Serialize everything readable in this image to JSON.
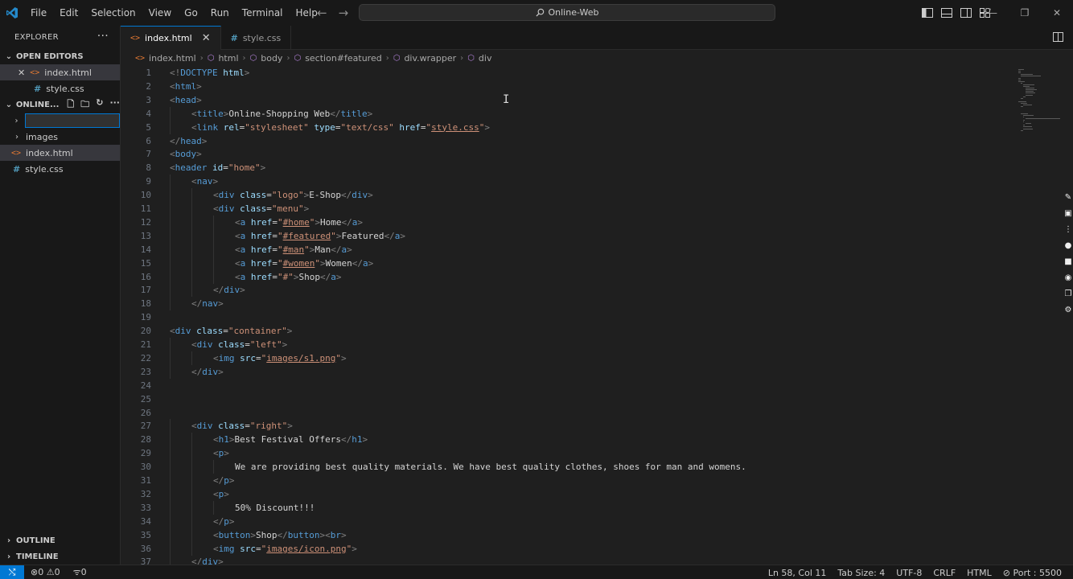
{
  "titlebar": {
    "menu": [
      "File",
      "Edit",
      "Selection",
      "View",
      "Go",
      "Run",
      "Terminal",
      "Help"
    ],
    "search": "Online-Web"
  },
  "sidebar": {
    "explorer_title": "EXPLORER",
    "open_editors_title": "OPEN EDITORS",
    "open_editors": [
      {
        "name": "index.html",
        "type": "html"
      },
      {
        "name": "style.css",
        "type": "css"
      }
    ],
    "folder_title": "ONLINE...",
    "tree": [
      {
        "name": "images",
        "type": "folder"
      },
      {
        "name": "index.html",
        "type": "html"
      },
      {
        "name": "style.css",
        "type": "css"
      }
    ],
    "outline": "OUTLINE",
    "timeline": "TIMELINE"
  },
  "tabs": [
    {
      "label": "index.html",
      "active": true
    },
    {
      "label": "style.css",
      "active": false
    }
  ],
  "breadcrumb": [
    "index.html",
    "html",
    "body",
    "section#featured",
    "div.wrapper",
    "div"
  ],
  "editor": {
    "lines": [
      {
        "n": 1,
        "indent": 0,
        "tokens": [
          [
            "p",
            "<!"
          ],
          [
            "t",
            "DOCTYPE "
          ],
          [
            "a",
            "html"
          ],
          [
            "p",
            ">"
          ]
        ]
      },
      {
        "n": 2,
        "indent": 0,
        "tokens": [
          [
            "p",
            "<"
          ],
          [
            "t",
            "html"
          ],
          [
            "p",
            ">"
          ]
        ]
      },
      {
        "n": 3,
        "indent": 0,
        "tokens": [
          [
            "p",
            "<"
          ],
          [
            "t",
            "head"
          ],
          [
            "p",
            ">"
          ]
        ]
      },
      {
        "n": 4,
        "indent": 1,
        "tokens": [
          [
            "p",
            "<"
          ],
          [
            "t",
            "title"
          ],
          [
            "p",
            ">"
          ],
          [
            "x",
            "Online-Shopping Web"
          ],
          [
            "p",
            "</"
          ],
          [
            "t",
            "title"
          ],
          [
            "p",
            ">"
          ]
        ]
      },
      {
        "n": 5,
        "indent": 1,
        "tokens": [
          [
            "p",
            "<"
          ],
          [
            "t",
            "link "
          ],
          [
            "a",
            "rel"
          ],
          [
            "x",
            "="
          ],
          [
            "s",
            "\"stylesheet\""
          ],
          [
            "x",
            " "
          ],
          [
            "a",
            "type"
          ],
          [
            "x",
            "="
          ],
          [
            "s",
            "\"text/css\""
          ],
          [
            "x",
            " "
          ],
          [
            "a",
            "href"
          ],
          [
            "x",
            "="
          ],
          [
            "s",
            "\""
          ],
          [
            "u",
            "style.css"
          ],
          [
            "s",
            "\""
          ],
          [
            "p",
            ">"
          ]
        ]
      },
      {
        "n": 6,
        "indent": 0,
        "tokens": [
          [
            "p",
            "</"
          ],
          [
            "t",
            "head"
          ],
          [
            "p",
            ">"
          ]
        ]
      },
      {
        "n": 7,
        "indent": 0,
        "tokens": [
          [
            "p",
            "<"
          ],
          [
            "t",
            "body"
          ],
          [
            "p",
            ">"
          ]
        ]
      },
      {
        "n": 8,
        "indent": 0,
        "tokens": [
          [
            "p",
            "<"
          ],
          [
            "t",
            "header "
          ],
          [
            "a",
            "id"
          ],
          [
            "x",
            "="
          ],
          [
            "s",
            "\"home\""
          ],
          [
            "p",
            ">"
          ]
        ]
      },
      {
        "n": 9,
        "indent": 1,
        "tokens": [
          [
            "p",
            "<"
          ],
          [
            "t",
            "nav"
          ],
          [
            "p",
            ">"
          ]
        ]
      },
      {
        "n": 10,
        "indent": 2,
        "tokens": [
          [
            "p",
            "<"
          ],
          [
            "t",
            "div "
          ],
          [
            "a",
            "class"
          ],
          [
            "x",
            "="
          ],
          [
            "s",
            "\"logo\""
          ],
          [
            "p",
            ">"
          ],
          [
            "x",
            "E-Shop"
          ],
          [
            "p",
            "</"
          ],
          [
            "t",
            "div"
          ],
          [
            "p",
            ">"
          ]
        ]
      },
      {
        "n": 11,
        "indent": 2,
        "tokens": [
          [
            "p",
            "<"
          ],
          [
            "t",
            "div "
          ],
          [
            "a",
            "class"
          ],
          [
            "x",
            "="
          ],
          [
            "s",
            "\"menu\""
          ],
          [
            "p",
            ">"
          ]
        ]
      },
      {
        "n": 12,
        "indent": 3,
        "tokens": [
          [
            "p",
            "<"
          ],
          [
            "t",
            "a "
          ],
          [
            "a",
            "href"
          ],
          [
            "x",
            "="
          ],
          [
            "s",
            "\""
          ],
          [
            "u",
            "#home"
          ],
          [
            "s",
            "\""
          ],
          [
            "p",
            ">"
          ],
          [
            "x",
            "Home"
          ],
          [
            "p",
            "</"
          ],
          [
            "t",
            "a"
          ],
          [
            "p",
            ">"
          ]
        ]
      },
      {
        "n": 13,
        "indent": 3,
        "tokens": [
          [
            "p",
            "<"
          ],
          [
            "t",
            "a "
          ],
          [
            "a",
            "href"
          ],
          [
            "x",
            "="
          ],
          [
            "s",
            "\""
          ],
          [
            "u",
            "#featured"
          ],
          [
            "s",
            "\""
          ],
          [
            "p",
            ">"
          ],
          [
            "x",
            "Featured"
          ],
          [
            "p",
            "</"
          ],
          [
            "t",
            "a"
          ],
          [
            "p",
            ">"
          ]
        ]
      },
      {
        "n": 14,
        "indent": 3,
        "tokens": [
          [
            "p",
            "<"
          ],
          [
            "t",
            "a "
          ],
          [
            "a",
            "href"
          ],
          [
            "x",
            "="
          ],
          [
            "s",
            "\""
          ],
          [
            "u",
            "#man"
          ],
          [
            "s",
            "\""
          ],
          [
            "p",
            ">"
          ],
          [
            "x",
            "Man"
          ],
          [
            "p",
            "</"
          ],
          [
            "t",
            "a"
          ],
          [
            "p",
            ">"
          ]
        ]
      },
      {
        "n": 15,
        "indent": 3,
        "tokens": [
          [
            "p",
            "<"
          ],
          [
            "t",
            "a "
          ],
          [
            "a",
            "href"
          ],
          [
            "x",
            "="
          ],
          [
            "s",
            "\""
          ],
          [
            "u",
            "#women"
          ],
          [
            "s",
            "\""
          ],
          [
            "p",
            ">"
          ],
          [
            "x",
            "Women"
          ],
          [
            "p",
            "</"
          ],
          [
            "t",
            "a"
          ],
          [
            "p",
            ">"
          ]
        ]
      },
      {
        "n": 16,
        "indent": 3,
        "tokens": [
          [
            "p",
            "<"
          ],
          [
            "t",
            "a "
          ],
          [
            "a",
            "href"
          ],
          [
            "x",
            "="
          ],
          [
            "s",
            "\"#\""
          ],
          [
            "p",
            ">"
          ],
          [
            "x",
            "Shop"
          ],
          [
            "p",
            "</"
          ],
          [
            "t",
            "a"
          ],
          [
            "p",
            ">"
          ]
        ]
      },
      {
        "n": 17,
        "indent": 2,
        "tokens": [
          [
            "p",
            "</"
          ],
          [
            "t",
            "div"
          ],
          [
            "p",
            ">"
          ]
        ]
      },
      {
        "n": 18,
        "indent": 1,
        "tokens": [
          [
            "p",
            "</"
          ],
          [
            "t",
            "nav"
          ],
          [
            "p",
            ">"
          ]
        ]
      },
      {
        "n": 19,
        "indent": 0,
        "tokens": []
      },
      {
        "n": 20,
        "indent": 0,
        "tokens": [
          [
            "p",
            "<"
          ],
          [
            "t",
            "div "
          ],
          [
            "a",
            "class"
          ],
          [
            "x",
            "="
          ],
          [
            "s",
            "\"container\""
          ],
          [
            "p",
            ">"
          ]
        ]
      },
      {
        "n": 21,
        "indent": 1,
        "tokens": [
          [
            "p",
            "<"
          ],
          [
            "t",
            "div "
          ],
          [
            "a",
            "class"
          ],
          [
            "x",
            "="
          ],
          [
            "s",
            "\"left\""
          ],
          [
            "p",
            ">"
          ]
        ]
      },
      {
        "n": 22,
        "indent": 2,
        "tokens": [
          [
            "p",
            "<"
          ],
          [
            "t",
            "img "
          ],
          [
            "a",
            "src"
          ],
          [
            "x",
            "="
          ],
          [
            "s",
            "\""
          ],
          [
            "u",
            "images/s1.png"
          ],
          [
            "s",
            "\""
          ],
          [
            "p",
            ">"
          ]
        ]
      },
      {
        "n": 23,
        "indent": 1,
        "tokens": [
          [
            "p",
            "</"
          ],
          [
            "t",
            "div"
          ],
          [
            "p",
            ">"
          ]
        ]
      },
      {
        "n": 24,
        "indent": 0,
        "tokens": []
      },
      {
        "n": 25,
        "indent": 0,
        "tokens": []
      },
      {
        "n": 26,
        "indent": 0,
        "tokens": []
      },
      {
        "n": 27,
        "indent": 1,
        "tokens": [
          [
            "p",
            "<"
          ],
          [
            "t",
            "div "
          ],
          [
            "a",
            "class"
          ],
          [
            "x",
            "="
          ],
          [
            "s",
            "\"right\""
          ],
          [
            "p",
            ">"
          ]
        ]
      },
      {
        "n": 28,
        "indent": 2,
        "tokens": [
          [
            "p",
            "<"
          ],
          [
            "t",
            "h1"
          ],
          [
            "p",
            ">"
          ],
          [
            "x",
            "Best Festival Offers"
          ],
          [
            "p",
            "</"
          ],
          [
            "t",
            "h1"
          ],
          [
            "p",
            ">"
          ]
        ]
      },
      {
        "n": 29,
        "indent": 2,
        "tokens": [
          [
            "p",
            "<"
          ],
          [
            "t",
            "p"
          ],
          [
            "p",
            ">"
          ]
        ]
      },
      {
        "n": 30,
        "indent": 3,
        "tokens": [
          [
            "x",
            "We are providing best quality materials. We have best quality clothes, shoes for man and womens."
          ]
        ]
      },
      {
        "n": 31,
        "indent": 2,
        "tokens": [
          [
            "p",
            "</"
          ],
          [
            "t",
            "p"
          ],
          [
            "p",
            ">"
          ]
        ]
      },
      {
        "n": 32,
        "indent": 2,
        "tokens": [
          [
            "p",
            "<"
          ],
          [
            "t",
            "p"
          ],
          [
            "p",
            ">"
          ]
        ]
      },
      {
        "n": 33,
        "indent": 3,
        "tokens": [
          [
            "x",
            "50% Discount!!!"
          ]
        ]
      },
      {
        "n": 34,
        "indent": 2,
        "tokens": [
          [
            "p",
            "</"
          ],
          [
            "t",
            "p"
          ],
          [
            "p",
            ">"
          ]
        ]
      },
      {
        "n": 35,
        "indent": 2,
        "tokens": [
          [
            "p",
            "<"
          ],
          [
            "t",
            "button"
          ],
          [
            "p",
            ">"
          ],
          [
            "x",
            "Shop"
          ],
          [
            "p",
            "</"
          ],
          [
            "t",
            "button"
          ],
          [
            "p",
            ">"
          ],
          [
            "p",
            "<"
          ],
          [
            "t",
            "br"
          ],
          [
            "p",
            ">"
          ]
        ]
      },
      {
        "n": 36,
        "indent": 2,
        "tokens": [
          [
            "p",
            "<"
          ],
          [
            "t",
            "img "
          ],
          [
            "a",
            "src"
          ],
          [
            "x",
            "="
          ],
          [
            "s",
            "\""
          ],
          [
            "u",
            "images/icon.png"
          ],
          [
            "s",
            "\""
          ],
          [
            "p",
            ">"
          ]
        ]
      },
      {
        "n": 37,
        "indent": 1,
        "tokens": [
          [
            "p",
            "</"
          ],
          [
            "t",
            "div"
          ],
          [
            "p",
            ">"
          ]
        ]
      }
    ]
  },
  "status": {
    "errors": "0",
    "warnings": "0",
    "ports_count": "0",
    "position": "Ln 58, Col 11",
    "tab_size": "Tab Size: 4",
    "encoding": "UTF-8",
    "eol": "CRLF",
    "language": "HTML",
    "port": "Port : 5500"
  }
}
